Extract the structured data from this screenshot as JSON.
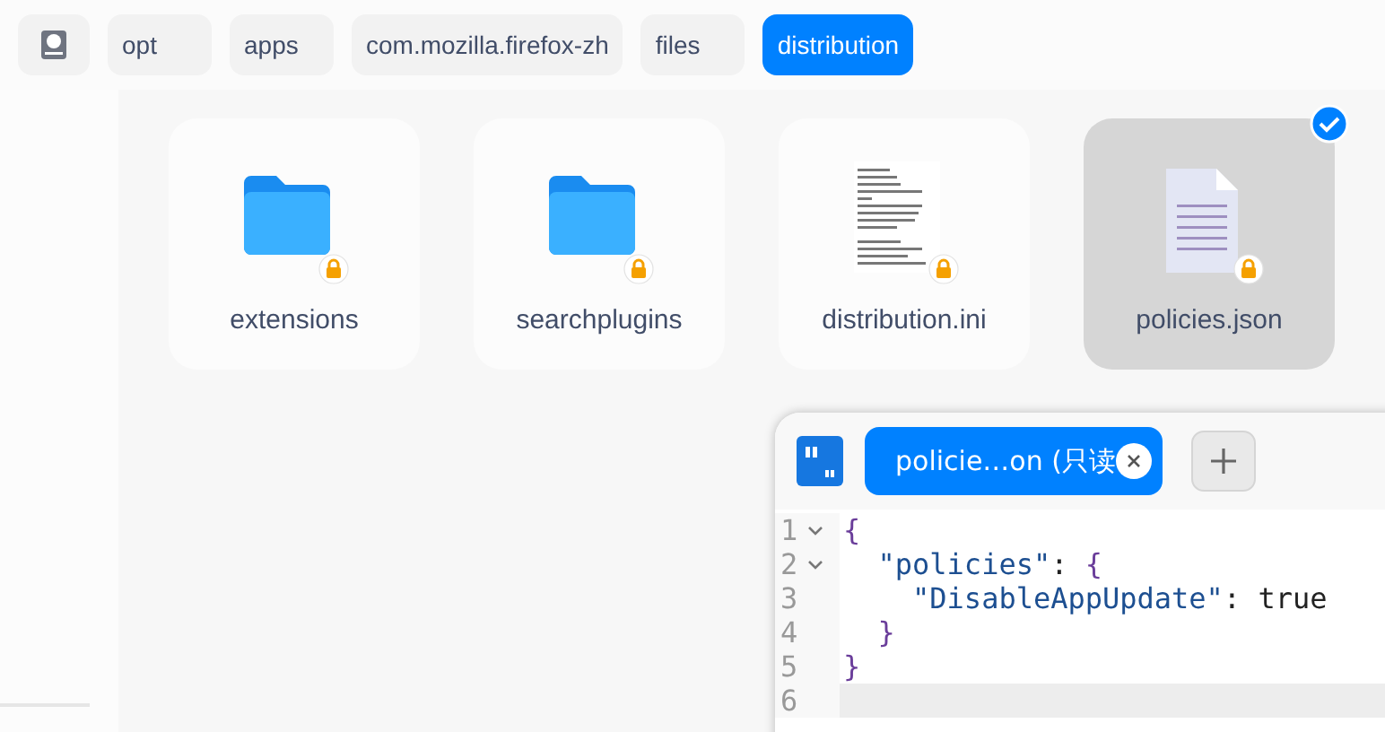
{
  "breadcrumbs": [
    {
      "label": "opt",
      "selected": false
    },
    {
      "label": "apps",
      "selected": false
    },
    {
      "label": "com.mozilla.firefox-zh",
      "selected": false
    },
    {
      "label": "files",
      "selected": false
    },
    {
      "label": "distribution",
      "selected": true
    }
  ],
  "files": [
    {
      "name": "extensions",
      "kind": "folder",
      "locked": true,
      "selected": false
    },
    {
      "name": "searchplugins",
      "kind": "folder",
      "locked": true,
      "selected": false
    },
    {
      "name": "distribution.ini",
      "kind": "preview",
      "locked": true,
      "selected": false
    },
    {
      "name": "policies.json",
      "kind": "document",
      "locked": true,
      "selected": true
    }
  ],
  "editor": {
    "tab": {
      "title": "policie…on (只读",
      "selected": true
    },
    "lines": [
      {
        "number": "1",
        "text": "{",
        "foldable": true,
        "current": false
      },
      {
        "number": "2",
        "text": "  \"policies\": {",
        "foldable": true,
        "current": false
      },
      {
        "number": "3",
        "text": "    \"DisableAppUpdate\": true",
        "foldable": false,
        "current": false
      },
      {
        "number": "4",
        "text": "  }",
        "foldable": false,
        "current": false
      },
      {
        "number": "5",
        "text": "}",
        "foldable": false,
        "current": false
      },
      {
        "number": "6",
        "foldable": false,
        "current": true
      }
    ]
  }
}
